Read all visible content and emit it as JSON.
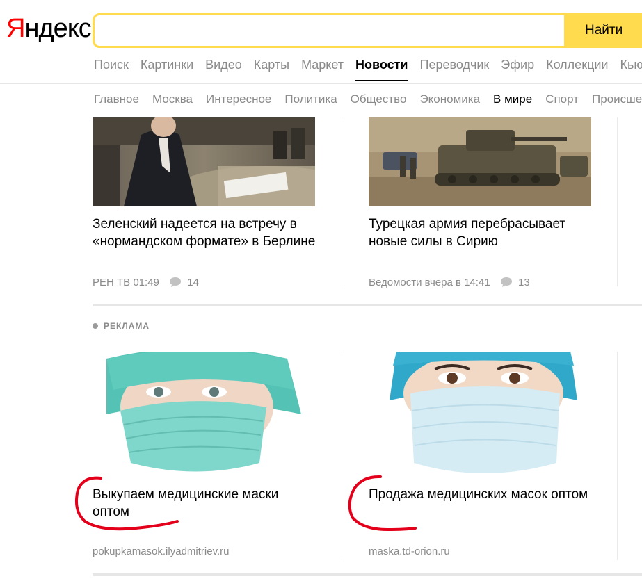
{
  "logo": {
    "first": "Я",
    "rest": "ндекс"
  },
  "search": {
    "value": "",
    "placeholder": "",
    "button_label": "Найти"
  },
  "services": [
    "Поиск",
    "Картинки",
    "Видео",
    "Карты",
    "Маркет",
    "Новости",
    "Переводчик",
    "Эфир",
    "Коллекции",
    "Кью"
  ],
  "services_active": "Новости",
  "rubrics": [
    "Главное",
    "Москва",
    "Интересное",
    "Политика",
    "Общество",
    "Экономика",
    "В мире",
    "Спорт",
    "Происшествия"
  ],
  "rubrics_active": "В мире",
  "news": [
    {
      "title": "Зеленский надеется на встречу в «нормандском формате» в Берлине",
      "source_time": "РЕН ТВ 01:49",
      "comments": "14",
      "image": "press-conference-photo"
    },
    {
      "title": "Турецкая армия перебрасывает новые силы в Сирию",
      "source_time": "Ведомости вчера в 14:41",
      "comments": "13",
      "image": "tanks-photo"
    }
  ],
  "ad_section": {
    "label": "РЕКЛАМА"
  },
  "ads": [
    {
      "title": "Выкупаем медицинские маски оптом",
      "domain": "pokupkamasok.ilyadmitriev.ru",
      "image": "woman-green-mask-photo"
    },
    {
      "title": "Продажа медицинских масок оптом",
      "domain": "maska.td-orion.ru",
      "image": "woman-blue-mask-photo"
    }
  ],
  "colors": {
    "logo_red": "#ff0000",
    "search_yellow": "#ffdb4d",
    "muted_text": "#8a8a8a",
    "annotation_red": "#e4001b"
  }
}
